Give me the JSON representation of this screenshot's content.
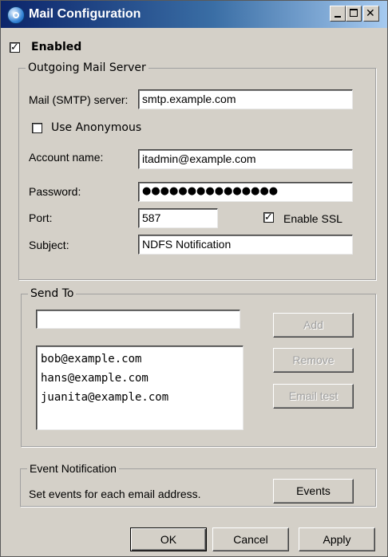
{
  "window": {
    "title": "Mail Configuration",
    "controls": {
      "minimize_icon": "minimize-icon",
      "maximize_icon": "maximize-icon",
      "close_icon": "close-icon",
      "close_glyph": "✕"
    }
  },
  "enabled": {
    "label": "Enabled",
    "checked": true
  },
  "outgoing": {
    "legend": "Outgoing Mail Server",
    "smtp_label": "Mail (SMTP) server:",
    "smtp_value": "smtp.example.com",
    "anonymous_label": "Use Anonymous",
    "anonymous_checked": false,
    "account_label": "Account name:",
    "account_value": "itadmin@example.com",
    "password_label": "Password:",
    "password_value": "●●●●●●●●●●●●●●●",
    "port_label": "Port:",
    "port_value": "587",
    "ssl_label": "Enable SSL",
    "ssl_checked": true,
    "subject_label": "Subject:",
    "subject_value": "NDFS Notification"
  },
  "send_to": {
    "legend": "Send To",
    "input_value": "",
    "add_label": "Add",
    "remove_label": "Remove",
    "email_test_label": "Email test",
    "recipients": [
      "bob@example.com",
      "hans@example.com",
      "juanita@example.com"
    ]
  },
  "events": {
    "legend": "Event Notification",
    "description": "Set events for each  email address.",
    "button_label": "Events"
  },
  "footer": {
    "ok_label": "OK",
    "cancel_label": "Cancel",
    "apply_label": "Apply"
  },
  "colors": {
    "titlebar_start": "#0b246a",
    "titlebar_end": "#a6caf0",
    "dialog_face": "#d4d0c8",
    "disabled_text": "#a0a0a0"
  }
}
